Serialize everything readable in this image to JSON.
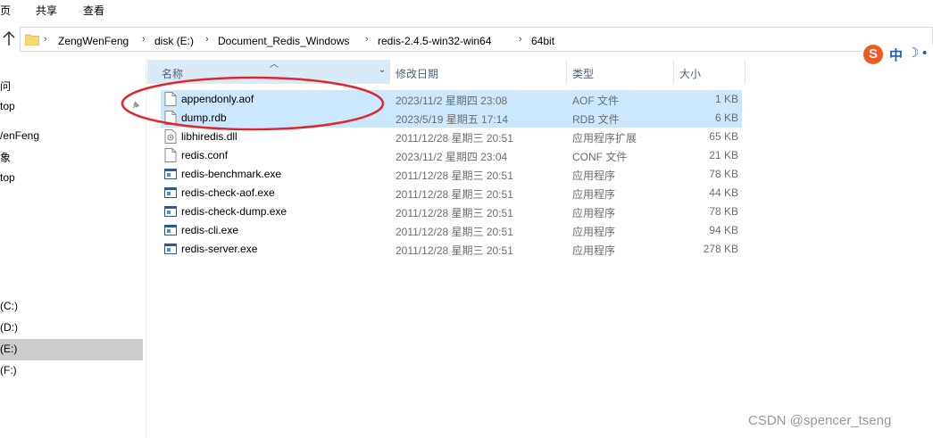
{
  "ribbon": {
    "tabs": [
      "页",
      "共享",
      "查看"
    ]
  },
  "address": {
    "crumbs": [
      "ZengWenFeng",
      "disk (E:)",
      "Document_Redis_Windows",
      "redis-2.4.5-win32-win64",
      "64bit"
    ]
  },
  "ime": {
    "logo": "S",
    "mode": "中",
    "moon": "☽",
    "dot": "•"
  },
  "nav": {
    "items": [
      "问",
      "top",
      "/enFeng",
      "象",
      "top",
      "(C:)",
      "(D:)",
      "(E:)",
      "(F:)"
    ]
  },
  "columns": {
    "name": "名称",
    "modified": "修改日期",
    "type": "类型",
    "size": "大小"
  },
  "files": [
    {
      "name": "appendonly.aof",
      "modified": "2023/11/2 星期四 23:08",
      "type": "AOF 文件",
      "size": "1 KB",
      "icon": "document-icon",
      "selected": true
    },
    {
      "name": "dump.rdb",
      "modified": "2023/5/19 星期五 17:14",
      "type": "RDB 文件",
      "size": "6 KB",
      "icon": "document-icon",
      "selected": true
    },
    {
      "name": "libhiredis.dll",
      "modified": "2011/12/28 星期三 20:51",
      "type": "应用程序扩展",
      "size": "65 KB",
      "icon": "dll-icon",
      "selected": false
    },
    {
      "name": "redis.conf",
      "modified": "2023/11/2 星期四 23:04",
      "type": "CONF 文件",
      "size": "21 KB",
      "icon": "document-icon",
      "selected": false
    },
    {
      "name": "redis-benchmark.exe",
      "modified": "2011/12/28 星期三 20:51",
      "type": "应用程序",
      "size": "78 KB",
      "icon": "exe-icon",
      "selected": false
    },
    {
      "name": "redis-check-aof.exe",
      "modified": "2011/12/28 星期三 20:51",
      "type": "应用程序",
      "size": "44 KB",
      "icon": "exe-icon",
      "selected": false
    },
    {
      "name": "redis-check-dump.exe",
      "modified": "2011/12/28 星期三 20:51",
      "type": "应用程序",
      "size": "78 KB",
      "icon": "exe-icon",
      "selected": false
    },
    {
      "name": "redis-cli.exe",
      "modified": "2011/12/28 星期三 20:51",
      "type": "应用程序",
      "size": "94 KB",
      "icon": "exe-icon",
      "selected": false
    },
    {
      "name": "redis-server.exe",
      "modified": "2011/12/28 星期三 20:51",
      "type": "应用程序",
      "size": "278 KB",
      "icon": "exe-icon",
      "selected": false
    }
  ],
  "watermark": "CSDN @spencer_tseng",
  "colors": {
    "selection": "#cce8ff",
    "header_active": "#d9ebf9",
    "annotation": "#e0262b"
  }
}
